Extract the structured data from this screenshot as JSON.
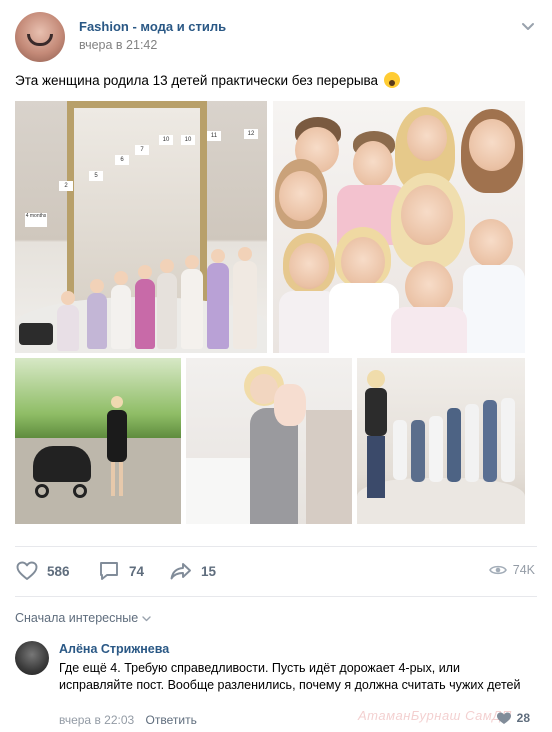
{
  "post": {
    "author": "Fashion - мода и стиль",
    "time": "вчера в 21:42",
    "text": "Эта женщина родила 13 детей практически без перерыва"
  },
  "photos": {
    "p1_labels": [
      "12",
      "11",
      "10",
      "10",
      "7",
      "6",
      "5",
      "2",
      "4 months"
    ]
  },
  "actions": {
    "likes": "586",
    "comments": "74",
    "shares": "15",
    "views": "74K"
  },
  "comments_sort": "Сначала интересные",
  "comment": {
    "author": "Алёна Стрижнева",
    "text": "Где ещё 4. Требую справедливости. Пусть идёт дорожает 4-рых, или исправляйте пост. Вообще разленились, почему я должна считать чужих детей",
    "time": "вчера в 22:03",
    "reply_label": "Ответить",
    "likes": "28"
  },
  "watermark": "АтаманБурнаш СамДП",
  "colors": {
    "link": "#2a5885",
    "muted": "#828282",
    "action": "#5f6d7d"
  },
  "icons": [
    "heart-icon",
    "comment-icon",
    "share-icon",
    "eye-icon",
    "chevron-down-icon"
  ]
}
